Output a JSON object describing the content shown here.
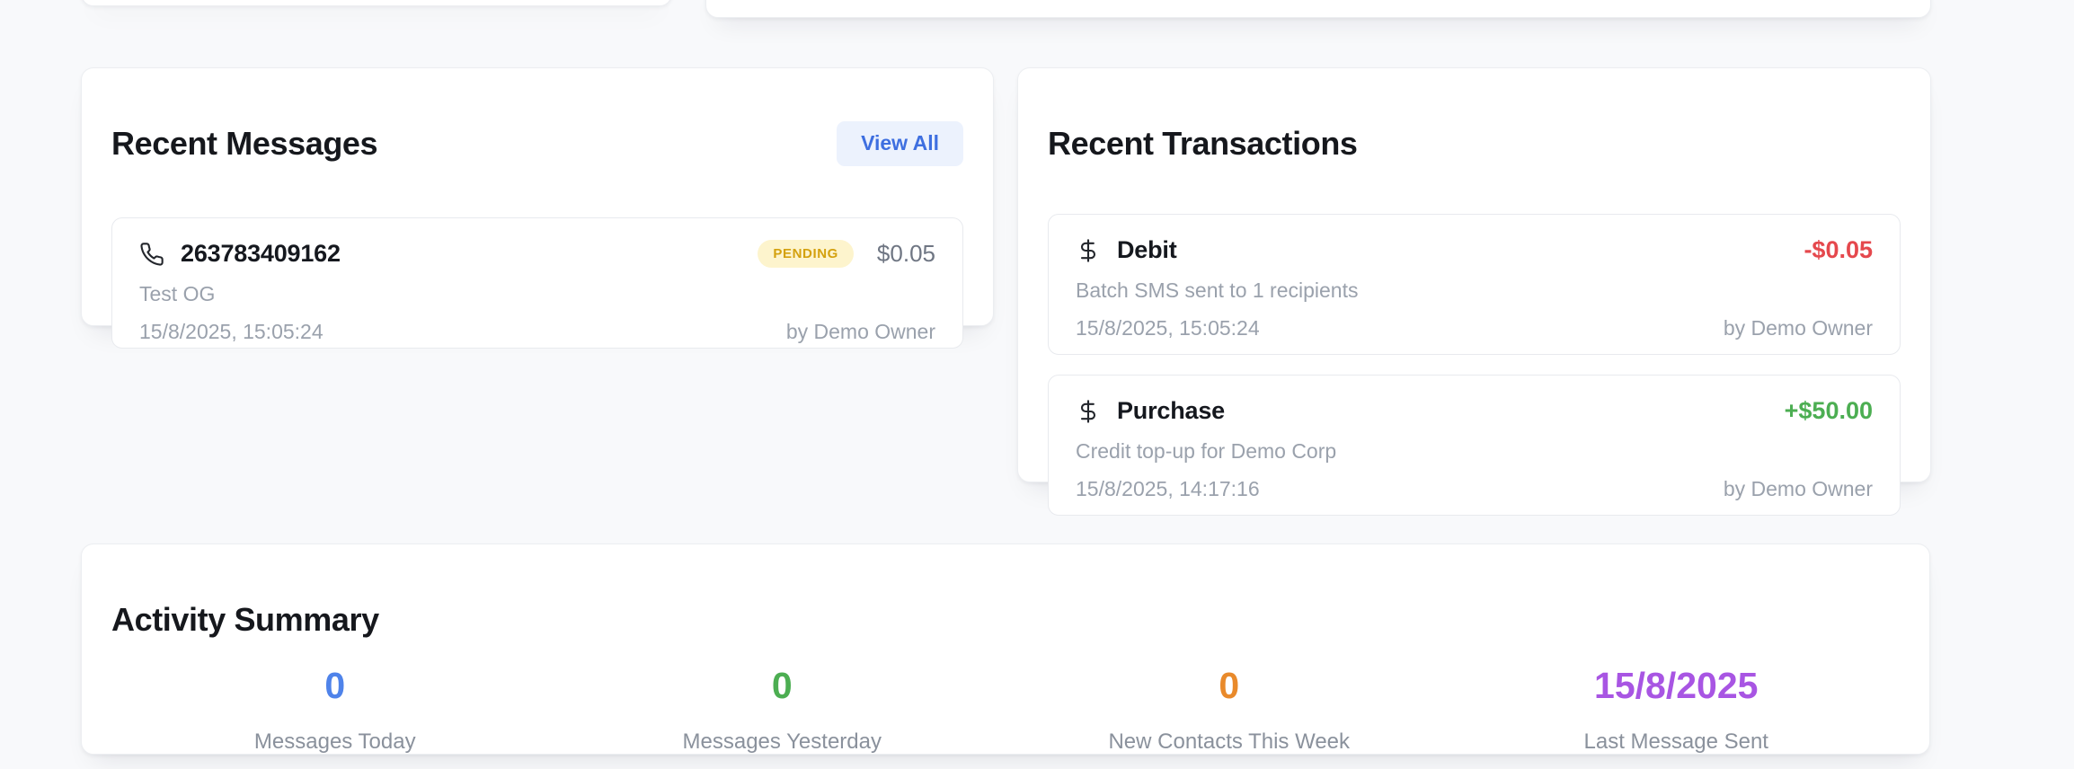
{
  "recent_messages": {
    "title": "Recent Messages",
    "view_all_label": "View All",
    "items": [
      {
        "icon": "phone-icon",
        "recipient": "263783409162",
        "status": "PENDING",
        "amount": "$0.05",
        "body": "Test OG",
        "timestamp": "15/8/2025, 15:05:24",
        "author": "by Demo Owner"
      }
    ]
  },
  "recent_transactions": {
    "title": "Recent Transactions",
    "items": [
      {
        "icon": "dollar-icon",
        "type": "Debit",
        "amount": "-$0.05",
        "amount_kind": "negative",
        "description": "Batch SMS sent to 1 recipients",
        "timestamp": "15/8/2025, 15:05:24",
        "author": "by Demo Owner"
      },
      {
        "icon": "dollar-icon",
        "type": "Purchase",
        "amount": "+$50.00",
        "amount_kind": "positive",
        "description": "Credit top-up for Demo Corp",
        "timestamp": "15/8/2025, 14:17:16",
        "author": "by Demo Owner"
      }
    ]
  },
  "activity_summary": {
    "title": "Activity Summary",
    "stats": [
      {
        "value": "0",
        "label": "Messages Today",
        "color": "#4f83ea"
      },
      {
        "value": "0",
        "label": "Messages Yesterday",
        "color": "#4cae52"
      },
      {
        "value": "0",
        "label": "New Contacts This Week",
        "color": "#e98a2b"
      },
      {
        "value": "15/8/2025",
        "label": "Last Message Sent",
        "color": "#a855e3"
      }
    ]
  },
  "colors": {
    "page_background": "#f8f9fb",
    "card_background": "#ffffff",
    "card_border": "#eceef1",
    "title_text": "#16181d",
    "secondary_text": "#9aa1ac",
    "status_pending_bg": "#fdf4cd",
    "status_pending_text": "#d4a10e",
    "view_all_bg": "#ecf2fd",
    "view_all_text": "#3e6fe0",
    "amount_negative": "#e5484d",
    "amount_positive": "#4cae52"
  }
}
